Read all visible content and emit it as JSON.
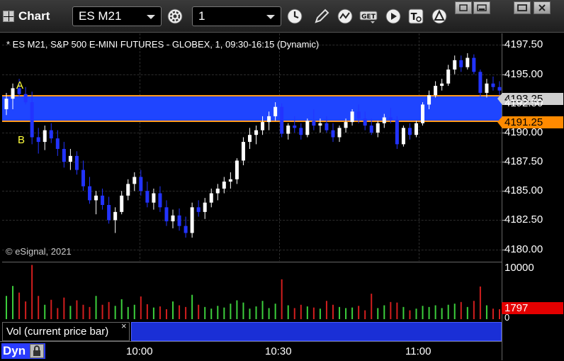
{
  "window": {
    "title": "Chart",
    "symbol": "ES M21",
    "interval": "1"
  },
  "toolbar_icons": [
    "settings-gear-icon",
    "clock-icon",
    "pencil-icon",
    "studies-icon",
    "get-icon",
    "play-icon",
    "text-icon",
    "alert-icon"
  ],
  "window_buttons": [
    "restore-icon",
    "minimize-icon",
    "maximize-icon",
    "close-icon"
  ],
  "chart": {
    "header": "* ES M21, S&P 500 E-MINI FUTURES - GLOBEX, 1, 09:30-16:15 (Dynamic)",
    "copyright": "© eSignal, 2021",
    "marker_a": "A",
    "marker_b": "B",
    "last_price": "4193.25",
    "support_price": "4191.25",
    "band_color": "#1f45ff",
    "band_border_color": "#ff9a1a"
  },
  "price_axis": {
    "ticks": [
      "4197.50",
      "4195.00",
      "4192.50",
      "4190.00",
      "4187.50",
      "4185.00",
      "4182.50",
      "4180.00"
    ]
  },
  "volume": {
    "label": "Vol (current price bar)",
    "close_label": "×",
    "ticks": [
      "10000",
      "0"
    ],
    "current": "1797"
  },
  "time_axis": {
    "ticks": [
      "10:00",
      "10:30",
      "11:00"
    ],
    "mode": "Dyn"
  },
  "chart_data": {
    "type": "candlestick",
    "title": "* ES M21, S&P 500 E-MINI FUTURES - GLOBEX, 1, 09:30-16:15 (Dynamic)",
    "ylim": [
      4180.0,
      4198.5
    ],
    "y_ticks": [
      4180.0,
      4182.5,
      4185.0,
      4187.5,
      4190.0,
      4192.5,
      4195.0,
      4197.5
    ],
    "x_ticks": [
      "10:00",
      "10:30",
      "11:00"
    ],
    "band": {
      "low": 4191.25,
      "high": 4193.6
    },
    "candles": [
      [
        4192.0,
        4193.4,
        4191.5,
        4192.9
      ],
      [
        4192.9,
        4194.2,
        4192.0,
        4193.8
      ],
      [
        4193.8,
        4194.6,
        4193.1,
        4193.3
      ],
      [
        4193.3,
        4193.9,
        4192.4,
        4192.6
      ],
      [
        4192.6,
        4193.5,
        4189.0,
        4189.6
      ],
      [
        4189.6,
        4190.4,
        4188.2,
        4189.2
      ],
      [
        4189.2,
        4190.6,
        4188.5,
        4190.2
      ],
      [
        4190.2,
        4190.8,
        4189.1,
        4189.5
      ],
      [
        4189.5,
        4190.2,
        4188.0,
        4188.6
      ],
      [
        4188.6,
        4189.2,
        4187.0,
        4187.5
      ],
      [
        4187.5,
        4188.6,
        4186.8,
        4188.0
      ],
      [
        4188.0,
        4188.4,
        4186.4,
        4186.8
      ],
      [
        4186.8,
        4187.6,
        4185.0,
        4185.4
      ],
      [
        4185.4,
        4186.2,
        4183.9,
        4184.2
      ],
      [
        4184.2,
        4185.0,
        4183.0,
        4184.6
      ],
      [
        4184.6,
        4185.2,
        4183.4,
        4183.8
      ],
      [
        4183.8,
        4184.5,
        4182.2,
        4182.5
      ],
      [
        4182.5,
        4183.6,
        4181.4,
        4183.2
      ],
      [
        4183.2,
        4185.0,
        4183.0,
        4184.6
      ],
      [
        4184.6,
        4186.0,
        4184.2,
        4185.6
      ],
      [
        4185.6,
        4186.6,
        4185.0,
        4186.2
      ],
      [
        4186.2,
        4186.8,
        4184.6,
        4185.0
      ],
      [
        4185.0,
        4185.8,
        4183.6,
        4184.0
      ],
      [
        4184.0,
        4185.2,
        4183.4,
        4184.8
      ],
      [
        4184.8,
        4185.4,
        4183.2,
        4183.6
      ],
      [
        4183.6,
        4184.2,
        4182.0,
        4182.4
      ],
      [
        4182.4,
        4183.4,
        4181.8,
        4182.9
      ],
      [
        4182.9,
        4183.5,
        4181.6,
        4182.0
      ],
      [
        4182.0,
        4182.8,
        4181.0,
        4181.4
      ],
      [
        4181.4,
        4184.0,
        4181.0,
        4183.6
      ],
      [
        4183.6,
        4184.2,
        4182.8,
        4183.2
      ],
      [
        4183.2,
        4184.4,
        4182.6,
        4184.0
      ],
      [
        4184.0,
        4185.2,
        4183.6,
        4184.8
      ],
      [
        4184.8,
        4185.6,
        4184.2,
        4185.2
      ],
      [
        4185.2,
        4186.2,
        4184.8,
        4185.8
      ],
      [
        4185.8,
        4186.6,
        4185.2,
        4186.0
      ],
      [
        4186.0,
        4187.8,
        4185.6,
        4187.6
      ],
      [
        4187.6,
        4189.6,
        4187.2,
        4189.2
      ],
      [
        4189.2,
        4190.4,
        4188.6,
        4189.8
      ],
      [
        4189.8,
        4190.6,
        4189.0,
        4190.2
      ],
      [
        4190.2,
        4191.4,
        4189.8,
        4190.9
      ],
      [
        4190.9,
        4191.8,
        4190.2,
        4191.4
      ],
      [
        4191.4,
        4192.6,
        4191.0,
        4192.2
      ],
      [
        4192.2,
        4192.5,
        4189.6,
        4189.9
      ],
      [
        4189.9,
        4190.8,
        4189.4,
        4190.6
      ],
      [
        4190.6,
        4191.4,
        4190.0,
        4190.4
      ],
      [
        4190.4,
        4190.8,
        4189.4,
        4189.8
      ],
      [
        4189.8,
        4191.2,
        4189.6,
        4191.0
      ],
      [
        4191.0,
        4192.0,
        4190.2,
        4190.6
      ],
      [
        4190.6,
        4191.2,
        4190.0,
        4190.8
      ],
      [
        4190.8,
        4191.4,
        4190.0,
        4190.2
      ],
      [
        4190.2,
        4190.8,
        4189.2,
        4189.6
      ],
      [
        4189.6,
        4190.6,
        4189.2,
        4190.4
      ],
      [
        4190.4,
        4191.2,
        4190.0,
        4190.9
      ],
      [
        4190.9,
        4192.0,
        4190.6,
        4191.8
      ],
      [
        4191.8,
        4192.4,
        4190.8,
        4191.2
      ],
      [
        4191.2,
        4191.8,
        4190.2,
        4190.6
      ],
      [
        4190.6,
        4191.2,
        4189.8,
        4190.0
      ],
      [
        4190.0,
        4191.0,
        4189.6,
        4190.8
      ],
      [
        4190.8,
        4191.6,
        4190.4,
        4191.3
      ],
      [
        4191.3,
        4192.1,
        4190.8,
        4191.1
      ],
      [
        4191.1,
        4191.4,
        4188.6,
        4189.0
      ],
      [
        4189.0,
        4190.6,
        4188.8,
        4190.4
      ],
      [
        4190.4,
        4190.8,
        4189.4,
        4189.8
      ],
      [
        4189.8,
        4191.0,
        4189.6,
        4190.8
      ],
      [
        4190.8,
        4192.6,
        4190.6,
        4192.4
      ],
      [
        4192.4,
        4193.6,
        4192.0,
        4193.2
      ],
      [
        4193.2,
        4194.4,
        4193.0,
        4194.0
      ],
      [
        4194.0,
        4194.6,
        4193.6,
        4194.2
      ],
      [
        4194.2,
        4195.8,
        4194.0,
        4195.4
      ],
      [
        4195.4,
        4196.6,
        4195.0,
        4196.2
      ],
      [
        4196.2,
        4196.6,
        4195.2,
        4195.6
      ],
      [
        4195.6,
        4196.8,
        4195.4,
        4196.4
      ],
      [
        4196.4,
        4196.7,
        4195.0,
        4195.2
      ],
      [
        4195.2,
        4195.4,
        4193.0,
        4193.4
      ],
      [
        4193.4,
        4194.6,
        4193.0,
        4194.2
      ],
      [
        4194.2,
        4194.8,
        4193.6,
        4193.9
      ],
      [
        4193.9,
        4194.4,
        4193.2,
        4193.6
      ]
    ],
    "volume": {
      "ylim": [
        0,
        10000
      ],
      "values": [
        4200,
        6000,
        4800,
        3200,
        9800,
        4200,
        2600,
        3500,
        2000,
        3900,
        2400,
        3400,
        2600,
        2200,
        4200,
        2600,
        3100,
        2400,
        3600,
        2200,
        2600,
        4100,
        2700,
        2100,
        2300,
        1800,
        3200,
        2500,
        2200,
        4400,
        2600,
        2200,
        1900,
        2400,
        2100,
        2800,
        3400,
        3000,
        1900,
        2300,
        3300,
        2000,
        2800,
        7200,
        2500,
        2000,
        2600,
        2300,
        2100,
        1900,
        3300,
        2600,
        2200,
        2000,
        2100,
        2400,
        1600,
        4600,
        2000,
        2500,
        3100,
        3000,
        2200,
        1600,
        1900,
        2400,
        2200,
        2500,
        2000,
        2600,
        2800,
        3100,
        2200,
        3300,
        5900,
        2500,
        1900,
        1797
      ]
    }
  }
}
